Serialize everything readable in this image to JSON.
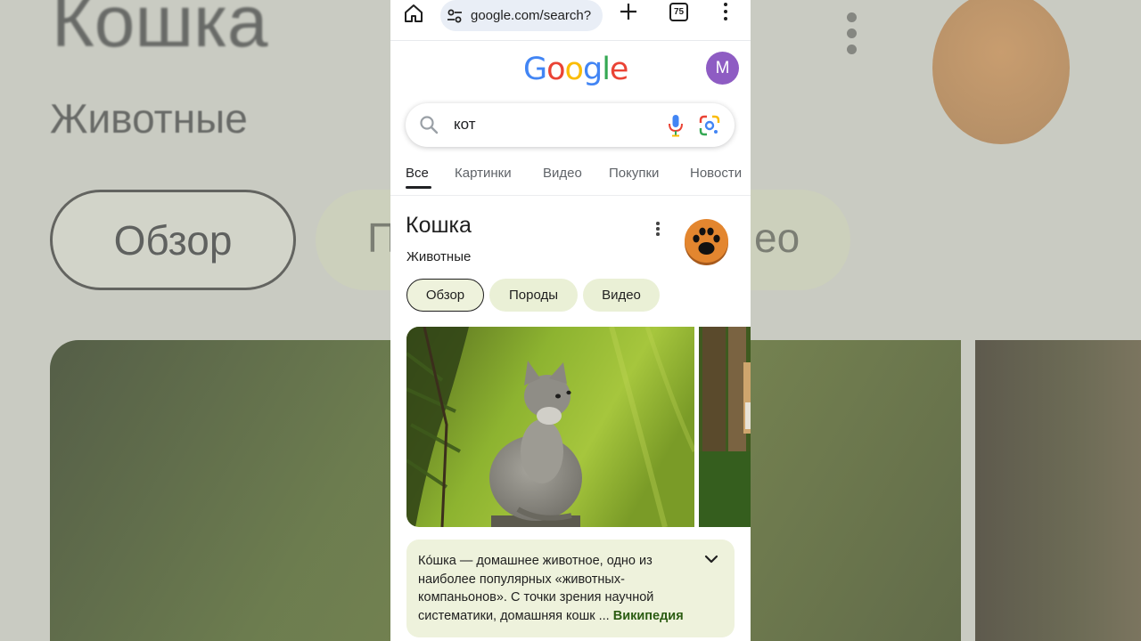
{
  "background": {
    "title": "Кошка",
    "subtitle": "Животные",
    "chip_overview": "Обзор",
    "chip_left_fragment": "П",
    "chip_right_fragment": "ео"
  },
  "browser": {
    "url": "google.com/search?",
    "tab_count": "75"
  },
  "google": {
    "logo": [
      "G",
      "o",
      "o",
      "g",
      "l",
      "e"
    ],
    "avatar_letter": "M",
    "search_value": "кот"
  },
  "nav_tabs": [
    {
      "label": "Все",
      "active": true
    },
    {
      "label": "Картинки",
      "active": false
    },
    {
      "label": "Видео",
      "active": false
    },
    {
      "label": "Покупки",
      "active": false
    },
    {
      "label": "Новости",
      "active": false
    }
  ],
  "knowledge_panel": {
    "title": "Кошка",
    "subtitle": "Животные",
    "chips": [
      {
        "label": "Обзор",
        "active": true
      },
      {
        "label": "Породы",
        "active": false
      },
      {
        "label": "Видео",
        "active": false
      }
    ],
    "snippet_text": "Ко́шка — домашнее животное, одно из наиболее популярных «животных-компаньонов». С точки зрения научной систематики, домашняя кошк ... ",
    "snippet_source": "Википедия"
  },
  "colors": {
    "accent_chip": "#eaf0d6",
    "avatar": "#8e5cc3",
    "link": "#2b5c12",
    "paw_badge": "#d07a2c"
  },
  "icons": [
    "home-icon",
    "tune-icon",
    "plus-icon",
    "tabs-icon",
    "more-vert-icon",
    "search-icon",
    "mic-icon",
    "google-lens-icon",
    "paw-icon",
    "chevron-down-icon"
  ]
}
